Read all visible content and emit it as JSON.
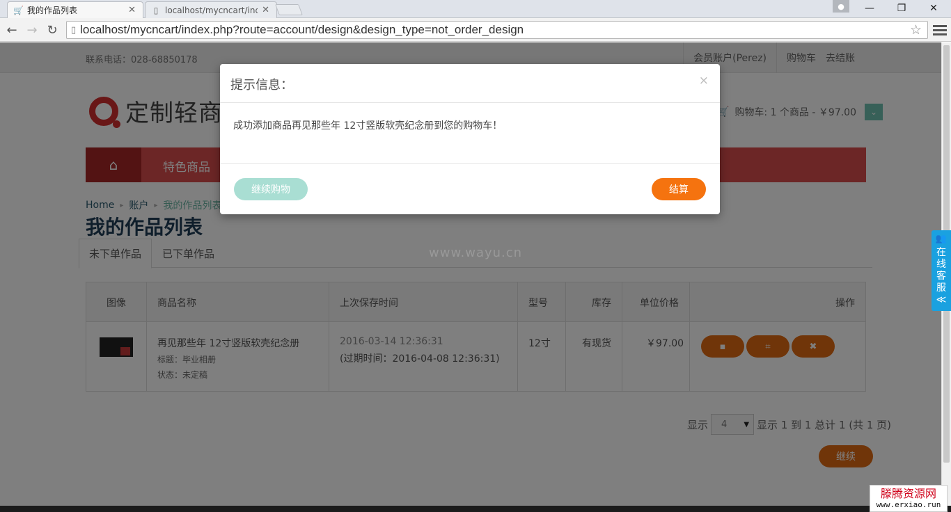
{
  "browser": {
    "tabs": [
      {
        "title": "我的作品列表",
        "icon": "cart-icon",
        "active": true
      },
      {
        "title": "localhost/mycncart/inde",
        "icon": "page-icon",
        "active": false
      }
    ],
    "url": "localhost/mycncart/index.php?route=account/design&design_type=not_order_design",
    "window_controls": {
      "minimize": "—",
      "restore": "❐",
      "close": "✕"
    }
  },
  "header": {
    "phone": "联系电话：028-68850178",
    "links": {
      "account": "会员账户(Perez)",
      "cart": "购物车",
      "checkout": "去结账"
    },
    "logo_text": "定制轻商",
    "cart_summary": "购物车: 1 个商品 - ￥97.00"
  },
  "nav": {
    "item1": "特色商品"
  },
  "breadcrumb": {
    "home": "Home",
    "account": "账户",
    "current": "我的作品列表"
  },
  "page_title": "我的作品列表",
  "tabs": {
    "not_ordered": "未下单作品",
    "ordered": "已下单作品"
  },
  "watermark": "www.wayu.cn",
  "table": {
    "headers": {
      "image": "图像",
      "name": "商品名称",
      "saved": "上次保存时间",
      "model": "型号",
      "stock": "库存",
      "price": "单位价格",
      "action": "操作"
    },
    "row": {
      "name": "再见那些年 12寸竖版软壳纪念册",
      "title": "标题：毕业相册",
      "status": "状态：未定稿",
      "saved": "2016-03-14 12:36:31",
      "expire": "(过期时间：2016-04-08 12:36:31)",
      "model": "12寸",
      "stock": "有现货",
      "price": "￥97.00"
    }
  },
  "pager": {
    "show_label": "显示",
    "per_page": "4",
    "summary": "显示 1 到 1 总计 1 (共 1 页)"
  },
  "continue_label": "继续",
  "support": {
    "text": [
      "在",
      "线",
      "客",
      "服"
    ],
    "arrow": "≪"
  },
  "modal": {
    "title": "提示信息：",
    "message": "成功添加商品再见那些年 12寸竖版软壳纪念册到您的购物车！",
    "continue_shopping": "继续购物",
    "checkout": "结算"
  },
  "corner_badge": {
    "name": "滕腾资源网",
    "url": "www.erxiao.run"
  },
  "colors": {
    "nav_red": "#d94c4c",
    "orange": "#f5730f",
    "teal": "#6fc1b0",
    "support_blue": "#1aa1e0"
  }
}
